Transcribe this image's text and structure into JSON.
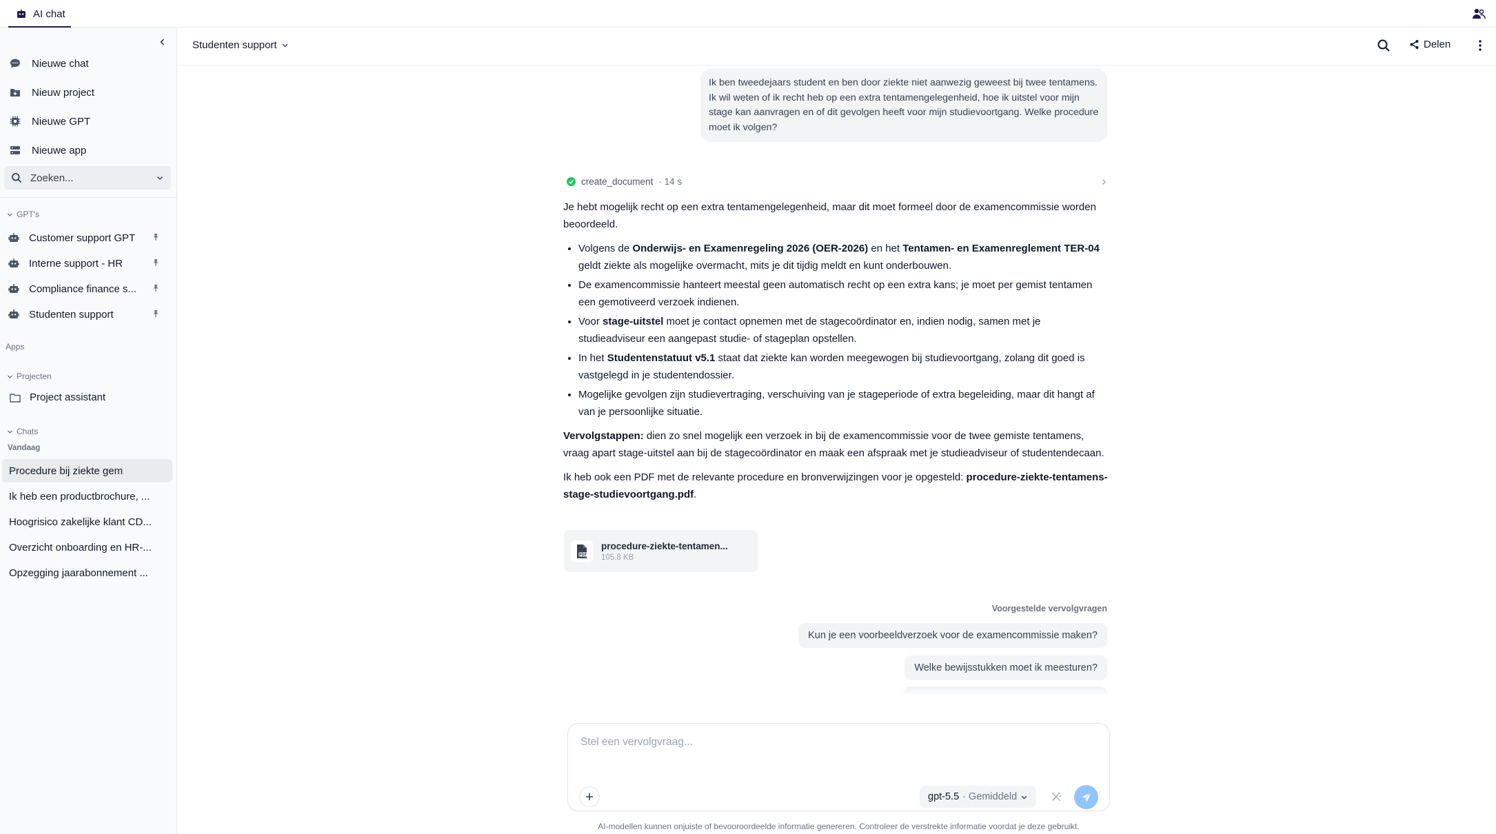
{
  "app": {
    "tab_label": "AI chat",
    "tab_icon": "robot-icon",
    "top_right_icon": "people-icon"
  },
  "sidebar": {
    "actions": [
      {
        "label": "Nieuwe chat",
        "icon": "chat-bubble-icon"
      },
      {
        "label": "Nieuw project",
        "icon": "folder-plus-icon"
      },
      {
        "label": "Nieuwe GPT",
        "icon": "chip-icon"
      },
      {
        "label": "Nieuwe app",
        "icon": "server-icon"
      }
    ],
    "search_placeholder": "Zoeken...",
    "gpts_heading": "GPT's",
    "gpts": [
      {
        "label": "Customer support GPT"
      },
      {
        "label": "Interne support - HR"
      },
      {
        "label": "Compliance finance s..."
      },
      {
        "label": "Studenten support"
      }
    ],
    "apps_heading": "Apps",
    "projects_heading": "Projecten",
    "projects": [
      {
        "label": "Project assistant"
      }
    ],
    "chats_heading": "Chats",
    "today_label": "Vandaag",
    "chats": [
      {
        "label": "Procedure bij ziekte gem",
        "active": true
      },
      {
        "label": "Ik heb een productbrochure, ..."
      },
      {
        "label": "Hoogrisico zakelijke klant CD..."
      },
      {
        "label": "Overzicht onboarding en HR-..."
      },
      {
        "label": "Opzegging jaarabonnement ..."
      }
    ]
  },
  "header": {
    "title": "Studenten support",
    "share_label": "Delen"
  },
  "conversation": {
    "user_message": "Ik ben tweedejaars student en ben door ziekte niet aanwezig geweest bij twee tentamens. Ik wil weten of ik recht heb op een extra tentamengelegenheid, hoe ik uitstel voor mijn stage kan aanvragen en of dit gevolgen heeft voor mijn studievoortgang. Welke procedure moet ik volgen?",
    "tool": {
      "name": "create_document",
      "duration": "· 14 s",
      "status_color": "#22c55e"
    },
    "answer": {
      "intro": "Je hebt mogelijk recht op een extra tentamengelegenheid, maar dit moet formeel door de examencommissie worden beoordeeld.",
      "bullets": [
        {
          "p1": "Volgens de ",
          "b1": "Onderwijs- en Examenregeling 2026 (OER-2026)",
          "p2": " en het ",
          "b2": "Tentamen- en Examenreglement TER-04",
          "p3": " geldt ziekte als mogelijke overmacht, mits je dit tijdig meldt en kunt onderbouwen."
        },
        {
          "p1": "De examencommissie hanteert meestal geen automatisch recht op een extra kans; je moet per gemist tentamen een gemotiveerd verzoek indienen."
        },
        {
          "p1": "Voor ",
          "b1": "stage-uitstel",
          "p2": " moet je contact opnemen met de stagecoördinator en, indien nodig, samen met je studieadviseur een aangepast studie- of stageplan opstellen."
        },
        {
          "p1": "In het ",
          "b1": "Studentenstatuut v5.1",
          "p2": " staat dat ziekte kan worden meegewogen bij studievoortgang, zolang dit goed is vastgelegd in je studentendossier."
        },
        {
          "p1": "Mogelijke gevolgen zijn studievertraging, verschuiving van je stageperiode of extra begeleiding, maar dit hangt af van je persoonlijke situatie."
        }
      ],
      "next_steps_label": "Vervolgstappen:",
      "next_steps_text": " dien zo snel mogelijk een verzoek in bij de examencommissie voor de twee gemiste tentamens, vraag apart stage-uitstel aan bij de stagecoördinator en maak een afspraak met je studieadviseur of studentendecaan.",
      "pdf_intro": "Ik heb ook een PDF met de relevante procedure en bronverwijzingen voor je opgesteld: ",
      "pdf_filename": "procedure-ziekte-tentamens-stage-studievoortgang.pdf",
      "pdf_end": "."
    },
    "file": {
      "name": "procedure-ziekte-tentamen...",
      "size": "105.8 KB",
      "icon": "pdf-file-icon"
    },
    "suggestions_title": "Voorgestelde vervolgvragen",
    "suggestions": [
      "Kun je een voorbeeldverzoek voor de examencommissie maken?",
      "Welke bewijsstukken moet ik meesturen?"
    ]
  },
  "composer": {
    "placeholder": "Stel een vervolgvraag...",
    "model": "gpt-5.5",
    "mode": "· Gemiddeld",
    "disclaimer": "AI-modellen kunnen onjuiste of bevooroordeelde informatie genereren. Controleer de verstrekte informatie voordat je deze gebruikt."
  }
}
